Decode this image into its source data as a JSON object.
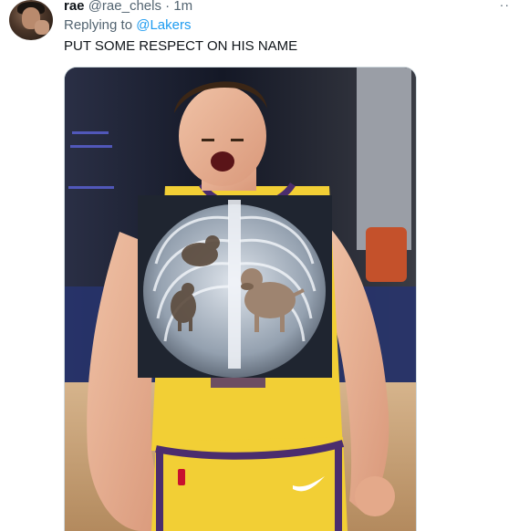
{
  "tweet": {
    "author_name": "rae",
    "author_handle": "@rae_chels",
    "separator": "·",
    "timestamp": "1m",
    "more_icon": "ellipsis-icon",
    "more_label": "··",
    "reply_prefix": "Replying to",
    "reply_mention": "@Lakers",
    "text": "PUT SOME RESPECT ON HIS NAME"
  },
  "media": {
    "alt": "Lakers player yelling with a chest x-ray of dogs overlaid on his chest"
  },
  "colors": {
    "text_primary": "#0f1419",
    "text_secondary": "#536471",
    "link": "#1d9bf0",
    "jersey_yellow": "#f2cf35",
    "jersey_purple": "#4b2d6e"
  }
}
